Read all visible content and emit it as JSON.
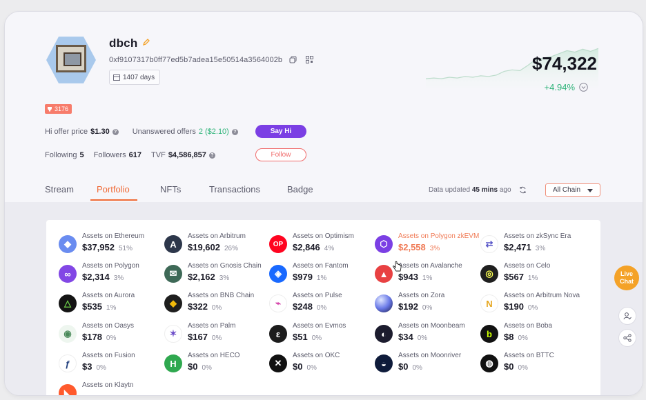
{
  "profile": {
    "username": "dbch",
    "address": "0xf9107317b0ff77ed5b7adea15e50514a3564002b",
    "days": "1407 days",
    "badge": "3176",
    "net_worth": "$74,322",
    "change": "+4.94%",
    "hi_offer_label": "Hi offer price",
    "hi_offer_value": "$1.30",
    "unanswered_label": "Unanswered offers",
    "unanswered_value": "2 ($2.10)",
    "following_label": "Following",
    "following_value": "5",
    "followers_label": "Followers",
    "followers_value": "617",
    "tvf_label": "TVF",
    "tvf_value": "$4,586,857",
    "say_hi_label": "Say Hi",
    "follow_label": "Follow"
  },
  "tabs": [
    {
      "label": "Stream"
    },
    {
      "label": "Portfolio"
    },
    {
      "label": "NFTs"
    },
    {
      "label": "Transactions"
    },
    {
      "label": "Badge"
    }
  ],
  "data_updated": {
    "prefix": "Data updated",
    "time": "45 mins",
    "suffix": "ago"
  },
  "chain_select": "All Chain",
  "live_chat": "Live Chat",
  "sparkline_points": [
    12,
    13,
    12,
    14,
    13,
    15,
    14,
    16,
    15,
    17,
    22,
    24,
    23,
    30,
    38,
    40,
    42,
    46,
    50,
    48,
    52,
    49,
    53
  ],
  "assets": [
    {
      "label": "Assets on Ethereum",
      "value": "$37,952",
      "pct": "51%",
      "icon": "ethereum-icon",
      "color": "#6a8cf0"
    },
    {
      "label": "Assets on Arbitrum",
      "value": "$19,602",
      "pct": "26%",
      "icon": "arbitrum-icon",
      "color": "#2d374b"
    },
    {
      "label": "Assets on Optimism",
      "value": "$2,846",
      "pct": "4%",
      "icon": "optimism-icon",
      "color": "#ff0420"
    },
    {
      "label": "Assets on Polygon zkEVM",
      "value": "$2,558",
      "pct": "3%",
      "icon": "polygon-zkevm-icon",
      "color": "#7b3fe4",
      "highlight": true
    },
    {
      "label": "Assets on zkSync Era",
      "value": "$2,471",
      "pct": "3%",
      "icon": "zksync-icon",
      "color": "#ffffff"
    },
    {
      "label": "Assets on Polygon",
      "value": "$2,314",
      "pct": "3%",
      "icon": "polygon-icon",
      "color": "#8247e5"
    },
    {
      "label": "Assets on Gnosis Chain",
      "value": "$2,162",
      "pct": "3%",
      "icon": "gnosis-icon",
      "color": "#3e6957"
    },
    {
      "label": "Assets on Fantom",
      "value": "$979",
      "pct": "1%",
      "icon": "fantom-icon",
      "color": "#1969ff"
    },
    {
      "label": "Assets on Avalanche",
      "value": "$943",
      "pct": "1%",
      "icon": "avalanche-icon",
      "color": "#e84142"
    },
    {
      "label": "Assets on Celo",
      "value": "$567",
      "pct": "1%",
      "icon": "celo-icon",
      "color": "#1f1f1f"
    },
    {
      "label": "Assets on Aurora",
      "value": "$535",
      "pct": "1%",
      "icon": "aurora-icon",
      "color": "#141414"
    },
    {
      "label": "Assets on BNB Chain",
      "value": "$322",
      "pct": "0%",
      "icon": "bnb-icon",
      "color": "#1e1e1e"
    },
    {
      "label": "Assets on Pulse",
      "value": "$248",
      "pct": "0%",
      "icon": "pulse-icon",
      "color": "#ffffff"
    },
    {
      "label": "Assets on Zora",
      "value": "$192",
      "pct": "0%",
      "icon": "zora-icon",
      "color": "#5b6bd8"
    },
    {
      "label": "Assets on Arbitrum Nova",
      "value": "$190",
      "pct": "0%",
      "icon": "arbitrum-nova-icon",
      "color": "#ffffff"
    },
    {
      "label": "Assets on Oasys",
      "value": "$178",
      "pct": "0%",
      "icon": "oasys-icon",
      "color": "#eef6ef"
    },
    {
      "label": "Assets on Palm",
      "value": "$167",
      "pct": "0%",
      "icon": "palm-icon",
      "color": "#ffffff"
    },
    {
      "label": "Assets on Evmos",
      "value": "$51",
      "pct": "0%",
      "icon": "evmos-icon",
      "color": "#1c1c1c"
    },
    {
      "label": "Assets on Moonbeam",
      "value": "$34",
      "pct": "0%",
      "icon": "moonbeam-icon",
      "color": "#1c1c2e"
    },
    {
      "label": "Assets on Boba",
      "value": "$8",
      "pct": "0%",
      "icon": "boba-icon",
      "color": "#111111"
    },
    {
      "label": "Assets on Fusion",
      "value": "$3",
      "pct": "0%",
      "icon": "fusion-icon",
      "color": "#ffffff"
    },
    {
      "label": "Assets on HECO",
      "value": "$0",
      "pct": "0%",
      "icon": "heco-icon",
      "color": "#2fa84f"
    },
    {
      "label": "Assets on OKC",
      "value": "$0",
      "pct": "0%",
      "icon": "okc-icon",
      "color": "#111111"
    },
    {
      "label": "Assets on Moonriver",
      "value": "$0",
      "pct": "0%",
      "icon": "moonriver-icon",
      "color": "#0e1b3a"
    },
    {
      "label": "Assets on BTTC",
      "value": "$0",
      "pct": "0%",
      "icon": "bttc-icon",
      "color": "#111111"
    },
    {
      "label": "Assets on Klaytn",
      "value": "",
      "pct": "",
      "icon": "klaytn-icon",
      "color": "#ff5a2d"
    }
  ]
}
